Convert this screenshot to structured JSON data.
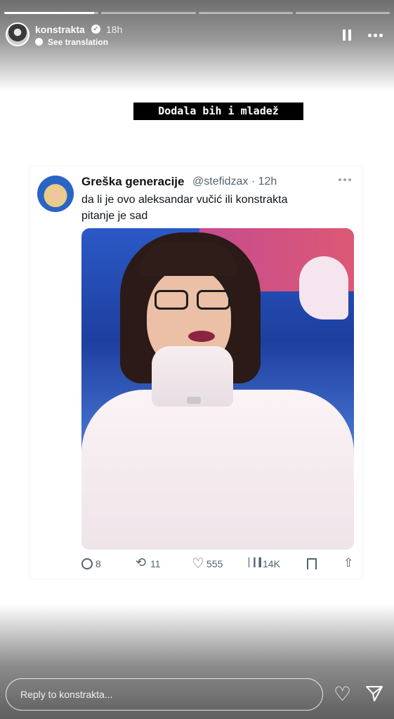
{
  "header": {
    "username": "konstrakta",
    "time": "18h",
    "translation_link": "See translation"
  },
  "progress": {
    "segments": 4,
    "active_index": 0,
    "active_fill": 0.95
  },
  "caption": "Dodala bih i mladež",
  "tweet": {
    "name": "Greška generacije",
    "handle": "@stefidzax · 12h",
    "text_line1": "da li je ovo aleksandar vučić ili konstrakta",
    "text_line2": "pitanje je sad",
    "actions": {
      "replies": "8",
      "retweets": "11",
      "likes": "555",
      "views": "14K"
    }
  },
  "reply": {
    "placeholder": "Reply to konstrakta..."
  },
  "icons": {
    "verified": "verified-icon",
    "globe": "globe-icon",
    "pause": "pause-icon",
    "more": "more-icon",
    "heart": "heart-icon",
    "send": "send-icon"
  },
  "colors": {
    "tweet_text": "#0f1419",
    "tweet_muted": "#536471",
    "caption_bg": "#000000"
  }
}
